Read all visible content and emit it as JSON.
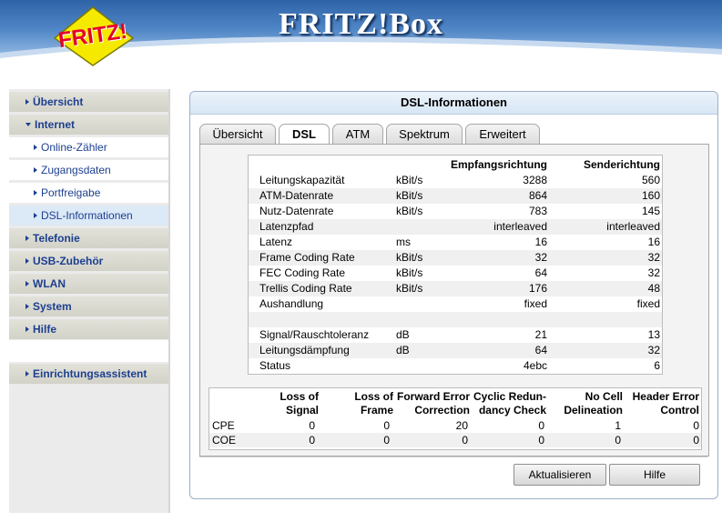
{
  "brand": {
    "title": "FRITZ!Box",
    "logo_text": "FRITZ!"
  },
  "sidebar": {
    "items": [
      {
        "label": "Übersicht"
      },
      {
        "label": "Internet"
      },
      {
        "label": "Online-Zähler"
      },
      {
        "label": "Zugangsdaten"
      },
      {
        "label": "Portfreigabe"
      },
      {
        "label": "DSL-Informationen"
      },
      {
        "label": "Telefonie"
      },
      {
        "label": "USB-Zubehör"
      },
      {
        "label": "WLAN"
      },
      {
        "label": "System"
      },
      {
        "label": "Hilfe"
      },
      {
        "label": "Einrichtungsassistent"
      }
    ]
  },
  "panel": {
    "title": "DSL-Informationen"
  },
  "tabs": [
    {
      "label": "Übersicht"
    },
    {
      "label": "DSL"
    },
    {
      "label": "ATM"
    },
    {
      "label": "Spektrum"
    },
    {
      "label": "Erweitert"
    }
  ],
  "dsl": {
    "headers": [
      "Empfangsrichtung",
      "Senderichtung"
    ],
    "rows": [
      {
        "name": "Leitungskapazität",
        "unit": "kBit/s",
        "rx": "3288",
        "tx": "560"
      },
      {
        "name": "ATM-Datenrate",
        "unit": "kBit/s",
        "rx": "864",
        "tx": "160"
      },
      {
        "name": "Nutz-Datenrate",
        "unit": "kBit/s",
        "rx": "783",
        "tx": "145"
      },
      {
        "name": "Latenzpfad",
        "unit": "",
        "rx": "interleaved",
        "tx": "interleaved"
      },
      {
        "name": "Latenz",
        "unit": "ms",
        "rx": "16",
        "tx": "16"
      },
      {
        "name": "Frame Coding Rate",
        "unit": "kBit/s",
        "rx": "32",
        "tx": "32"
      },
      {
        "name": "FEC Coding Rate",
        "unit": "kBit/s",
        "rx": "64",
        "tx": "32"
      },
      {
        "name": "Trellis Coding Rate",
        "unit": "kBit/s",
        "rx": "176",
        "tx": "48"
      },
      {
        "name": "Aushandlung",
        "unit": "",
        "rx": "fixed",
        "tx": "fixed"
      },
      {
        "name": "",
        "unit": "",
        "rx": "",
        "tx": ""
      },
      {
        "name": "Signal/Rauschtoleranz",
        "unit": "dB",
        "rx": "21",
        "tx": "13"
      },
      {
        "name": "Leitungsdämpfung",
        "unit": "dB",
        "rx": "64",
        "tx": "32"
      },
      {
        "name": "Status",
        "unit": "",
        "rx": "4ebc",
        "tx": "6"
      }
    ]
  },
  "errors": {
    "headers": [
      [
        "Loss of",
        "Signal"
      ],
      [
        "Loss of",
        "Frame"
      ],
      [
        "Forward Error",
        "Correction"
      ],
      [
        "Cyclic Redun-",
        "dancy Check"
      ],
      [
        "No Cell",
        "Delineation"
      ],
      [
        "Header Error",
        "Control"
      ]
    ],
    "rows": [
      {
        "name": "CPE",
        "values": [
          "0",
          "0",
          "20",
          "0",
          "1",
          "0"
        ]
      },
      {
        "name": "COE",
        "values": [
          "0",
          "0",
          "0",
          "0",
          "0",
          "0"
        ]
      }
    ]
  },
  "buttons": {
    "refresh": "Aktualisieren",
    "help": "Hilfe"
  }
}
